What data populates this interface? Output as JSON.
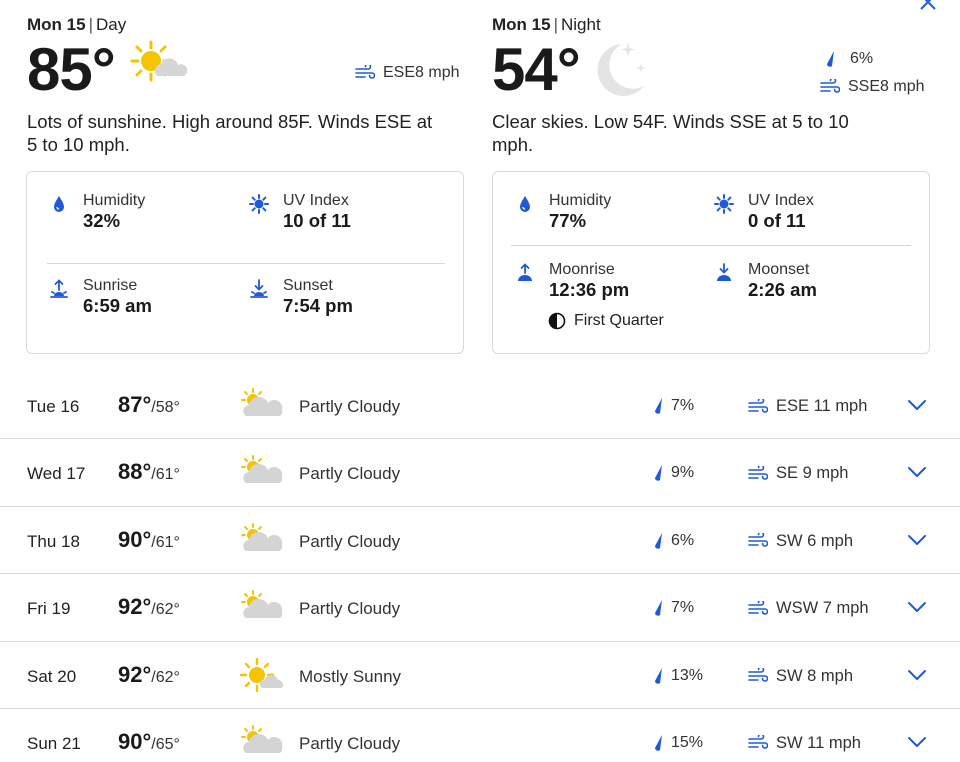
{
  "today": {
    "day": {
      "date_label": "Mon 15",
      "period": "Day",
      "temp": "85°",
      "wind": "ESE8 mph",
      "description": "Lots of sunshine. High around 85F. Winds ESE at 5 to 10 mph.",
      "stats": {
        "humidity_label": "Humidity",
        "humidity_value": "32%",
        "uv_label": "UV Index",
        "uv_value": "10 of 11",
        "sunrise_label": "Sunrise",
        "sunrise_value": "6:59 am",
        "sunset_label": "Sunset",
        "sunset_value": "7:54 pm"
      }
    },
    "night": {
      "date_label": "Mon 15",
      "period": "Night",
      "temp": "54°",
      "precip": "6%",
      "wind": "SSE8 mph",
      "description": "Clear skies. Low 54F. Winds SSE at 5 to 10 mph.",
      "stats": {
        "humidity_label": "Humidity",
        "humidity_value": "77%",
        "uv_label": "UV Index",
        "uv_value": "0 of 11",
        "moonrise_label": "Moonrise",
        "moonrise_value": "12:36 pm",
        "moonset_label": "Moonset",
        "moonset_value": "2:26 am",
        "moon_phase": "First Quarter"
      }
    }
  },
  "forecast": [
    {
      "day": "Tue 16",
      "hi": "87°",
      "lo": "/58°",
      "icon": "partly-cloudy-icon",
      "condition": "Partly Cloudy",
      "precip": "7%",
      "wind": "ESE 11 mph"
    },
    {
      "day": "Wed 17",
      "hi": "88°",
      "lo": "/61°",
      "icon": "partly-cloudy-icon",
      "condition": "Partly Cloudy",
      "precip": "9%",
      "wind": "SE 9 mph"
    },
    {
      "day": "Thu 18",
      "hi": "90°",
      "lo": "/61°",
      "icon": "partly-cloudy-icon",
      "condition": "Partly Cloudy",
      "precip": "6%",
      "wind": "SW 6 mph"
    },
    {
      "day": "Fri 19",
      "hi": "92°",
      "lo": "/62°",
      "icon": "partly-cloudy-icon",
      "condition": "Partly Cloudy",
      "precip": "7%",
      "wind": "WSW 7 mph"
    },
    {
      "day": "Sat 20",
      "hi": "92°",
      "lo": "/62°",
      "icon": "mostly-sunny-icon",
      "condition": "Mostly Sunny",
      "precip": "13%",
      "wind": "SW 8 mph"
    },
    {
      "day": "Sun 21",
      "hi": "90°",
      "lo": "/65°",
      "icon": "partly-cloudy-icon",
      "condition": "Partly Cloudy",
      "precip": "15%",
      "wind": "SW 11 mph"
    }
  ],
  "colors": {
    "accent": "#1f5ad6",
    "sun": "#f5c400",
    "cloud": "#d4d4d4",
    "divider": "#d9d9d9"
  }
}
